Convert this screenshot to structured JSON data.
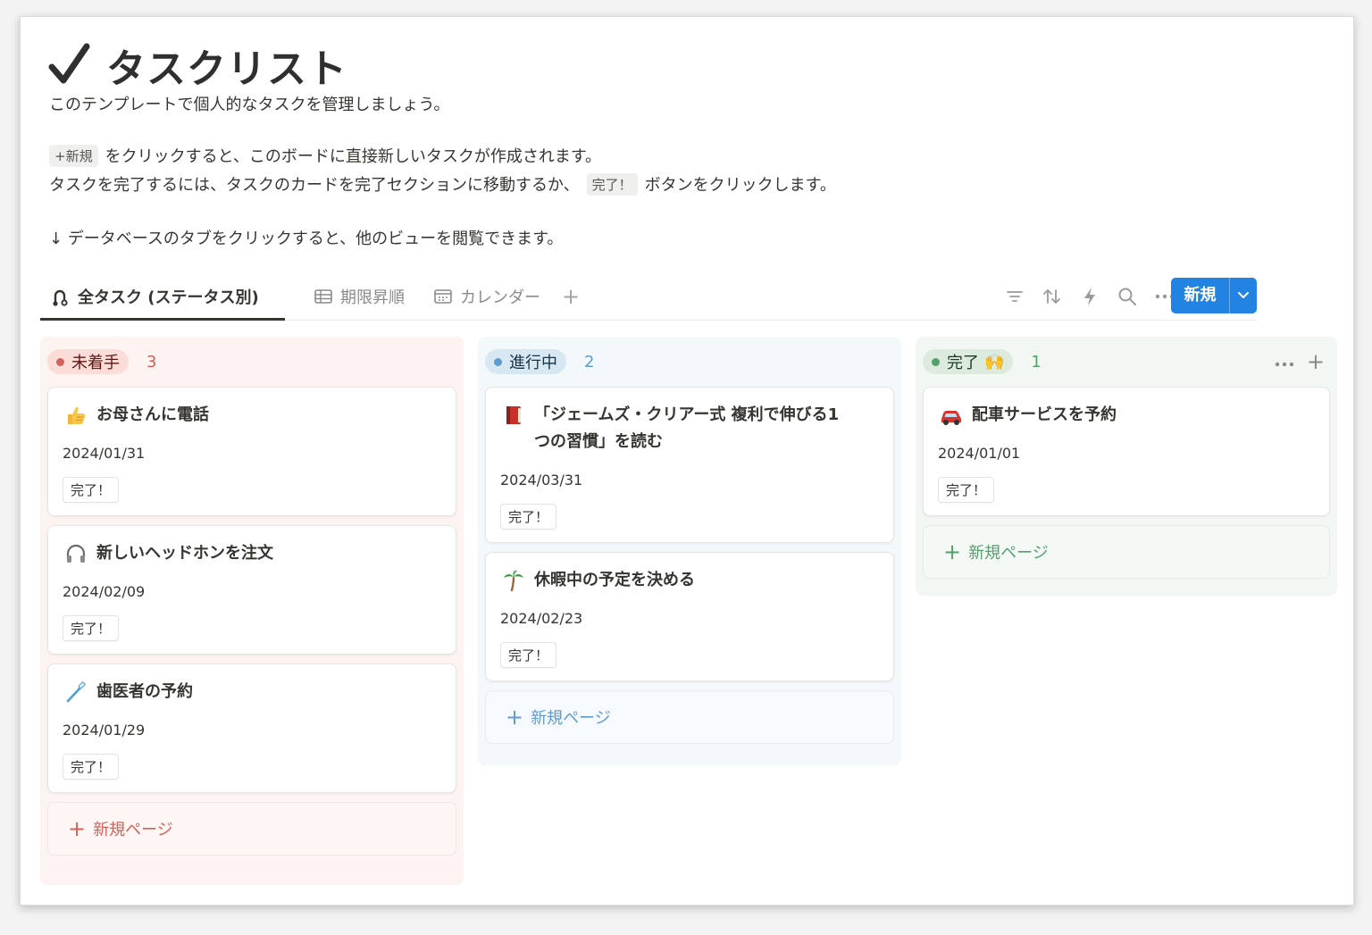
{
  "page": {
    "title": "タスクリスト",
    "description_1": "このテンプレートで個人的なタスクを管理しましょう。",
    "new_chip": "+新規",
    "description_2": "をクリックすると、このボードに直接新しいタスクが作成されます。",
    "description_3a": "タスクを完了するには、タスクのカードを完了セクションに移動するか、",
    "done_chip": "完了！",
    "description_3b": "ボタンをクリックします。",
    "description_4": "↓ データベースのタブをクリックすると、他のビューを閲覧できます。"
  },
  "tabs": [
    {
      "label": "全タスク (ステータス別)",
      "icon": "board-icon",
      "active": true
    },
    {
      "label": "期限昇順",
      "icon": "table-icon",
      "active": false
    },
    {
      "label": "カレンダー",
      "icon": "calendar-icon",
      "active": false
    }
  ],
  "toolbar": {
    "icons": [
      "filter-icon",
      "sort-icon",
      "lightning-icon",
      "search-icon",
      "more-icon"
    ],
    "new_label": "新規"
  },
  "columns": [
    {
      "status": "未着手",
      "count": "3",
      "color": "#d2625a",
      "cards": [
        {
          "emoji": "thumbs-up-icon",
          "title": "お母さんに電話",
          "date": "2024/01/31",
          "button": "完了！"
        },
        {
          "emoji": "headphones-icon",
          "title": "新しいヘッドホンを注文",
          "date": "2024/02/09",
          "button": "完了！"
        },
        {
          "emoji": "toothbrush-icon",
          "title": "歯医者の予約",
          "date": "2024/01/29",
          "button": "完了！"
        }
      ],
      "add_label": "新規ページ"
    },
    {
      "status": "進行中",
      "count": "2",
      "color": "#5f9bd0",
      "cards": [
        {
          "emoji": "book-icon",
          "title_line1": "「ジェームズ・クリアー式 複利で伸びる1",
          "title_line2": "つの習慣」を読む",
          "date": "2024/03/31",
          "button": "完了！"
        },
        {
          "emoji": "palm-tree-icon",
          "title": "休暇中の予定を決める",
          "date": "2024/02/23",
          "button": "完了！"
        }
      ],
      "add_label": "新規ページ"
    },
    {
      "status": "完了",
      "status_emoji": "🙌",
      "count": "1",
      "color": "#54a06c",
      "cards": [
        {
          "emoji": "car-icon",
          "title": "配車サービスを予約",
          "date": "2024/01/01",
          "button": "完了！"
        }
      ],
      "add_label": "新規ページ"
    }
  ]
}
